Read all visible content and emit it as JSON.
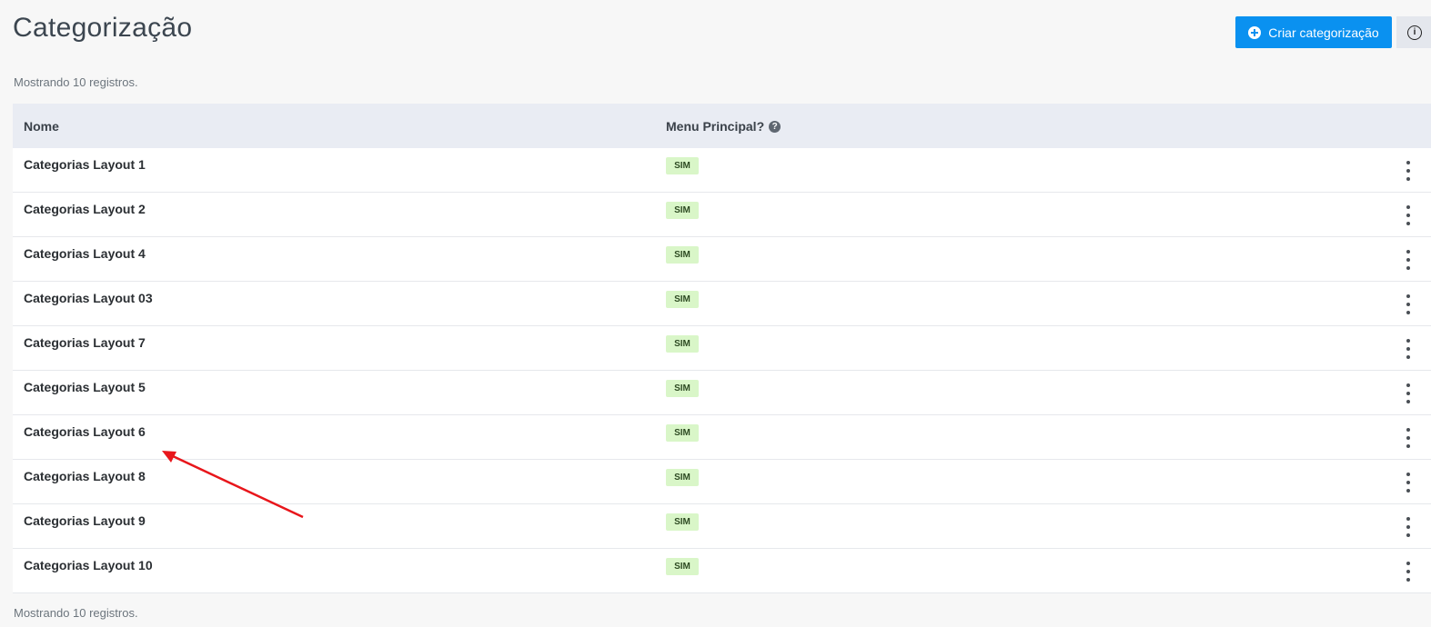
{
  "header": {
    "title": "Categorização",
    "create_button_label": "Criar categorização",
    "info_icon_glyph": "i"
  },
  "summary": {
    "top_text": "Mostrando 10 registros.",
    "bottom_text": "Mostrando 10 registros."
  },
  "table": {
    "columns": {
      "name": "Nome",
      "menu_principal": "Menu Principal?",
      "help_glyph": "?"
    },
    "rows": [
      {
        "name": "Categorias Layout 1",
        "menu_principal": "SIM"
      },
      {
        "name": "Categorias Layout 2",
        "menu_principal": "SIM"
      },
      {
        "name": "Categorias Layout 4",
        "menu_principal": "SIM"
      },
      {
        "name": "Categorias Layout 03",
        "menu_principal": "SIM"
      },
      {
        "name": "Categorias Layout 7",
        "menu_principal": "SIM"
      },
      {
        "name": "Categorias Layout 5",
        "menu_principal": "SIM"
      },
      {
        "name": "Categorias Layout 6",
        "menu_principal": "SIM"
      },
      {
        "name": "Categorias Layout 8",
        "menu_principal": "SIM"
      },
      {
        "name": "Categorias Layout 9",
        "menu_principal": "SIM"
      },
      {
        "name": "Categorias Layout 10",
        "menu_principal": "SIM"
      }
    ]
  },
  "icons": {
    "create": "plus-circle-icon",
    "info": "info-circle-icon",
    "help": "question-circle-icon",
    "row_actions": "kebab-menu-icon",
    "annotation": "red-arrow-icon"
  },
  "colors": {
    "primary": "#0a91f0",
    "badge_bg": "#d9f6c8",
    "header_bg": "#e9ecf3",
    "annotation": "#e8161b"
  }
}
